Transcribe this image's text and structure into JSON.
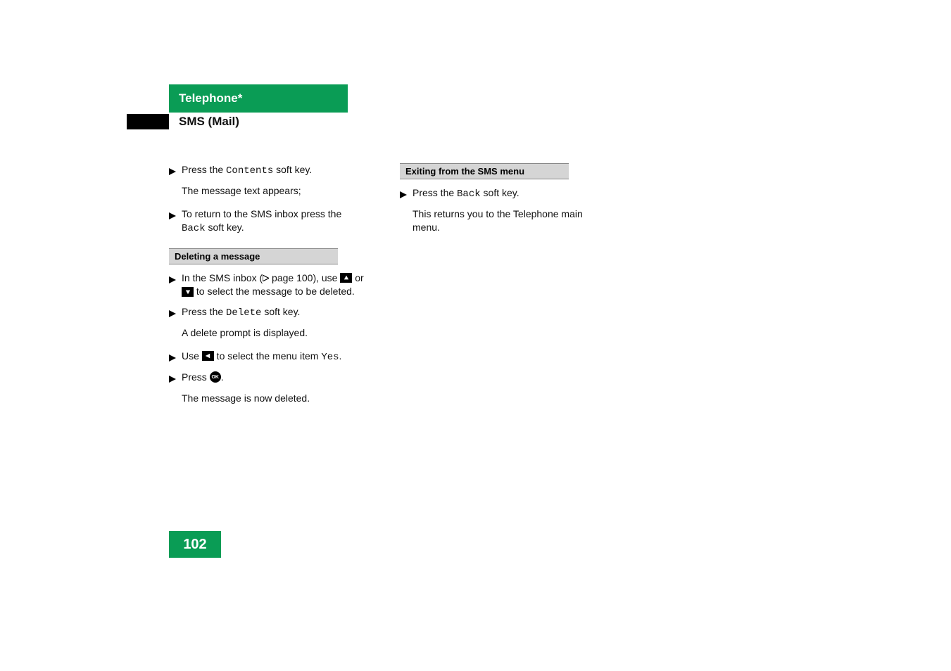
{
  "header": {
    "chapter": "Telephone*",
    "section": "SMS (Mail)"
  },
  "col1": {
    "step1_a": "Press the ",
    "step1_key": "Contents",
    "step1_b": " soft key.",
    "result1": "The message text appears;",
    "step2_a": "To return to the SMS inbox press the ",
    "step2_key": "Back",
    "step2_b": " soft key.",
    "sub1": "Deleting a message",
    "step3_a": "In the SMS inbox (",
    "step3_ref": " page 100), use ",
    "step3_b": " or ",
    "step3_c": " to select the message to be deleted.",
    "step4_a": "Press the ",
    "step4_key": "Delete",
    "step4_b": " soft key.",
    "result4": "A delete prompt is displayed.",
    "step5_a": "Use ",
    "step5_b": " to select the menu item ",
    "step5_key": "Yes",
    "step5_c": ".",
    "step6_a": "Press ",
    "step6_b": ".",
    "result6": "The message is now deleted.",
    "ok_label": "OK"
  },
  "col2": {
    "sub1": "Exiting from the SMS menu",
    "step1_a": "Press the ",
    "step1_key": "Back",
    "step1_b": " soft key.",
    "result1": "This returns you to the Telephone main menu."
  },
  "page_number": "102"
}
